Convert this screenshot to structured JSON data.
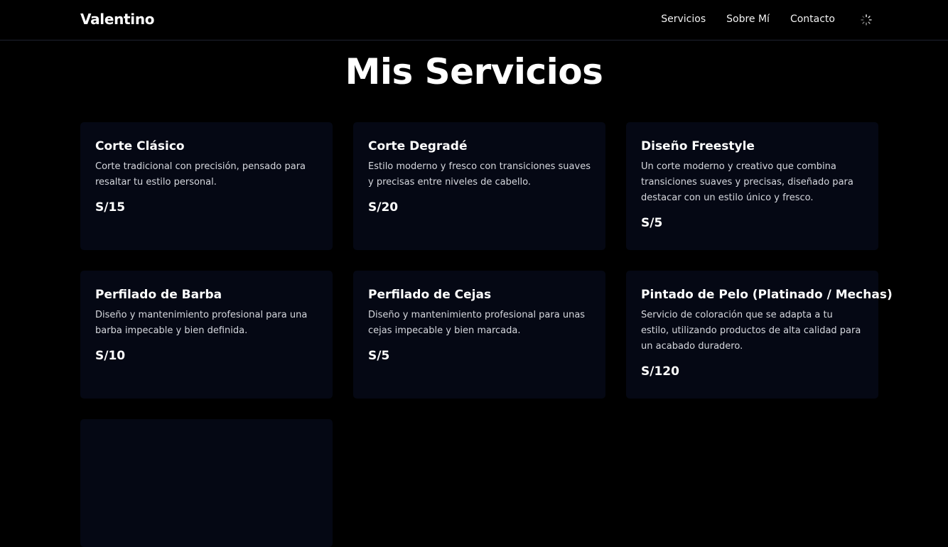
{
  "brand": "Valentino",
  "nav": {
    "links": [
      "Servicios",
      "Sobre Mí",
      "Contacto"
    ]
  },
  "theme_toggle_icon": "spinner-icon",
  "colors": {
    "background": "#000000",
    "card": "#050814",
    "text": "#ffffff"
  },
  "page_title": "Mis Servicios",
  "services": [
    {
      "title": "Corte Clásico",
      "description": "Corte tradicional con precisión, pensado para resaltar tu estilo personal.",
      "price": "S/15"
    },
    {
      "title": "Corte Degradé",
      "description": "Estilo moderno y fresco con transiciones suaves y precisas entre niveles de cabello.",
      "price": "S/20"
    },
    {
      "title": "Diseño Freestyle",
      "description": "Un corte moderno y creativo que combina transiciones suaves y precisas, diseñado para destacar con un estilo único y fresco.",
      "price": "S/5"
    },
    {
      "title": "Perfilado de Barba",
      "description": "Diseño y mantenimiento profesional para una barba impecable y bien definida.",
      "price": "S/10"
    },
    {
      "title": "Perfilado de Cejas",
      "description": "Diseño y mantenimiento profesional para unas cejas impecable y bien marcada.",
      "price": "S/5"
    },
    {
      "title": "Pintado de Pelo (Platinado / Mechas)",
      "description": "Servicio de coloración que se adapta a tu estilo, utilizando productos de alta calidad para un acabado duradero.",
      "price": "S/120"
    }
  ]
}
